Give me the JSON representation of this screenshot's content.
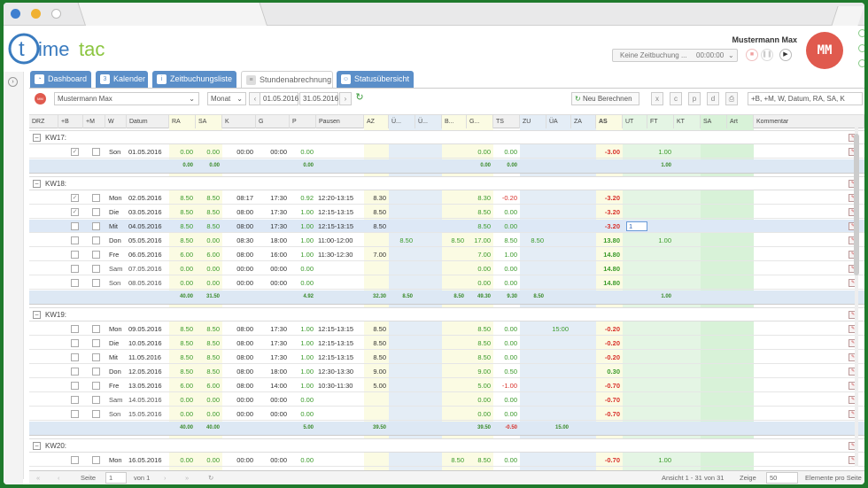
{
  "brand": {
    "logo": "timetac",
    "accent": "#5b8fc9",
    "logo_blue": "#3a7bbf",
    "logo_green": "#8bc53f"
  },
  "user": {
    "name": "Mustermann Max",
    "initials": "MM"
  },
  "clock": {
    "status": "Keine Zeitbuchung ...",
    "time": "00:00:00"
  },
  "nav_tabs": [
    {
      "label": "Dashboard",
      "icon": "dashboard-icon"
    },
    {
      "label": "Kalender",
      "icon": "calendar-icon"
    },
    {
      "label": "Zeitbuchungsliste",
      "icon": "info-icon"
    },
    {
      "label": "Stundenabrechnung",
      "icon": "document-icon",
      "active": true
    },
    {
      "label": "Statusübersicht",
      "icon": "people-icon"
    }
  ],
  "toolbar": {
    "employee": "Mustermann Max",
    "employee_initials": "MM",
    "period": "Monat",
    "date_from": "01.05.2016",
    "date_to": "31.05.2016",
    "recalc": "Neu Berechnen",
    "columns": "+B, +M, W, Datum, RA, SA, K"
  },
  "headers": [
    "DRZ",
    "+B",
    "+M",
    "W",
    "Datum",
    "RA",
    "SA",
    "K",
    "G",
    "P",
    "Pausen",
    "AZ",
    "Ü...",
    "Ü...",
    "B...",
    "G...",
    "TS",
    "ZU",
    "ÜA",
    "ZA",
    "AS",
    "UT",
    "FT",
    "KT",
    "SA",
    "Art",
    "Kommentar"
  ],
  "groups": [
    {
      "label": "KW17:",
      "rows": [
        {
          "b": true,
          "w": "Son",
          "d": "01.05.2016",
          "ra": "0.00",
          "sa": "0.00",
          "k": "00:00",
          "g": "00:00",
          "p": "0.00",
          "pa": "",
          "az": "",
          "u1": "",
          "u2": "",
          "bz": "",
          "gz": "0.00",
          "ts": "0.00",
          "zu": "",
          "ua": "",
          "za": "",
          "as": "-3.00",
          "ut": "",
          "ft": "1.00",
          "kt": ""
        }
      ],
      "sum": {
        "ra": "0.00",
        "sa": "0.00",
        "p": "0.00",
        "az": "",
        "u1": "",
        "bz": "",
        "gz": "0.00",
        "ts": "0.00",
        "zu": "",
        "ua": "",
        "ft": "1.00"
      }
    },
    {
      "label": "KW18:",
      "rows": [
        {
          "b": true,
          "w": "Mon",
          "d": "02.05.2016",
          "ra": "8.50",
          "sa": "8.50",
          "k": "08:17",
          "g": "17:30",
          "p": "0.92",
          "pa": "12:20-13:15",
          "az": "8.30",
          "u1": "",
          "u2": "",
          "bz": "",
          "gz": "8.30",
          "ts": "-0.20",
          "zu": "",
          "ua": "",
          "za": "",
          "as": "-3.20",
          "ut": "",
          "ft": "",
          "kt": ""
        },
        {
          "b": true,
          "w": "Die",
          "d": "03.05.2016",
          "ra": "8.50",
          "sa": "8.50",
          "k": "08:00",
          "g": "17:30",
          "p": "1.00",
          "pa": "12:15-13:15",
          "az": "8.50",
          "u1": "",
          "u2": "",
          "bz": "",
          "gz": "8.50",
          "ts": "0.00",
          "zu": "",
          "ua": "",
          "za": "",
          "as": "-3.20",
          "ut": "",
          "ft": "",
          "kt": ""
        },
        {
          "b": false,
          "hl": true,
          "w": "Mit",
          "d": "04.05.2016",
          "ra": "8.50",
          "sa": "8.50",
          "k": "08:00",
          "g": "17:30",
          "p": "1.00",
          "pa": "12:15-13:15",
          "az": "8.50",
          "u1": "",
          "u2": "",
          "bz": "",
          "gz": "8.50",
          "ts": "0.00",
          "zu": "",
          "ua": "",
          "za": "",
          "as": "-3.20",
          "ut": "1",
          "ft": "",
          "kt": ""
        },
        {
          "b": false,
          "w": "Don",
          "d": "05.05.2016",
          "ra": "8.50",
          "sa": "0.00",
          "k": "08:30",
          "g": "18:00",
          "p": "1.00",
          "pa": "11:00-12:00",
          "az": "",
          "u1": "8.50",
          "u2": "",
          "bz": "8.50",
          "gz": "17.00",
          "ts": "8.50",
          "zu": "8.50",
          "ua": "",
          "za": "",
          "as": "13.80",
          "ut": "",
          "ft": "1.00",
          "kt": ""
        },
        {
          "b": false,
          "w": "Fre",
          "d": "06.05.2016",
          "ra": "6.00",
          "sa": "6.00",
          "k": "08:00",
          "g": "16:00",
          "p": "1.00",
          "pa": "11:30-12:30",
          "az": "7.00",
          "u1": "",
          "u2": "",
          "bz": "",
          "gz": "7.00",
          "ts": "1.00",
          "zu": "",
          "ua": "",
          "za": "",
          "as": "14.80",
          "ut": "",
          "ft": "",
          "kt": ""
        },
        {
          "b": false,
          "we": true,
          "w": "Sam",
          "d": "07.05.2016",
          "ra": "0.00",
          "sa": "0.00",
          "k": "00:00",
          "g": "00:00",
          "p": "0.00",
          "pa": "",
          "az": "",
          "u1": "",
          "u2": "",
          "bz": "",
          "gz": "0.00",
          "ts": "0.00",
          "zu": "",
          "ua": "",
          "za": "",
          "as": "14.80",
          "ut": "",
          "ft": "",
          "kt": ""
        },
        {
          "b": false,
          "we": true,
          "w": "Son",
          "d": "08.05.2016",
          "ra": "0.00",
          "sa": "0.00",
          "k": "00:00",
          "g": "00:00",
          "p": "0.00",
          "pa": "",
          "az": "",
          "u1": "",
          "u2": "",
          "bz": "",
          "gz": "0.00",
          "ts": "0.00",
          "zu": "",
          "ua": "",
          "za": "",
          "as": "14.80",
          "ut": "",
          "ft": "",
          "kt": ""
        }
      ],
      "sum": {
        "ra": "40.00",
        "sa": "31.50",
        "p": "4.92",
        "az": "32.30",
        "u1": "8.50",
        "bz": "8.50",
        "gz": "49.30",
        "ts": "9.30",
        "zu": "8.50",
        "ua": "",
        "ft": "1.00"
      }
    },
    {
      "label": "KW19:",
      "rows": [
        {
          "b": false,
          "w": "Mon",
          "d": "09.05.2016",
          "ra": "8.50",
          "sa": "8.50",
          "k": "08:00",
          "g": "17:30",
          "p": "1.00",
          "pa": "12:15-13:15",
          "az": "8.50",
          "u1": "",
          "u2": "",
          "bz": "",
          "gz": "8.50",
          "ts": "0.00",
          "zu": "",
          "ua": "15:00",
          "za": "",
          "as": "-0.20",
          "ut": "",
          "ft": "",
          "kt": ""
        },
        {
          "b": false,
          "w": "Die",
          "d": "10.05.2016",
          "ra": "8.50",
          "sa": "8.50",
          "k": "08:00",
          "g": "17:30",
          "p": "1.00",
          "pa": "12:15-13:15",
          "az": "8.50",
          "u1": "",
          "u2": "",
          "bz": "",
          "gz": "8.50",
          "ts": "0.00",
          "zu": "",
          "ua": "",
          "za": "",
          "as": "-0.20",
          "ut": "",
          "ft": "",
          "kt": ""
        },
        {
          "b": false,
          "w": "Mit",
          "d": "11.05.2016",
          "ra": "8.50",
          "sa": "8.50",
          "k": "08:00",
          "g": "17:30",
          "p": "1.00",
          "pa": "12:15-13:15",
          "az": "8.50",
          "u1": "",
          "u2": "",
          "bz": "",
          "gz": "8.50",
          "ts": "0.00",
          "zu": "",
          "ua": "",
          "za": "",
          "as": "-0.20",
          "ut": "",
          "ft": "",
          "kt": ""
        },
        {
          "b": false,
          "w": "Don",
          "d": "12.05.2016",
          "ra": "8.50",
          "sa": "8.50",
          "k": "08:00",
          "g": "18:00",
          "p": "1.00",
          "pa": "12:30-13:30",
          "az": "9.00",
          "u1": "",
          "u2": "",
          "bz": "",
          "gz": "9.00",
          "ts": "0.50",
          "zu": "",
          "ua": "",
          "za": "",
          "as": "0.30",
          "ut": "",
          "ft": "",
          "kt": ""
        },
        {
          "b": false,
          "w": "Fre",
          "d": "13.05.2016",
          "ra": "6.00",
          "sa": "6.00",
          "k": "08:00",
          "g": "14:00",
          "p": "1.00",
          "pa": "10:30-11:30",
          "az": "5.00",
          "u1": "",
          "u2": "",
          "bz": "",
          "gz": "5.00",
          "ts": "-1.00",
          "zu": "",
          "ua": "",
          "za": "",
          "as": "-0.70",
          "ut": "",
          "ft": "",
          "kt": ""
        },
        {
          "b": false,
          "we": true,
          "w": "Sam",
          "d": "14.05.2016",
          "ra": "0.00",
          "sa": "0.00",
          "k": "00:00",
          "g": "00:00",
          "p": "0.00",
          "pa": "",
          "az": "",
          "u1": "",
          "u2": "",
          "bz": "",
          "gz": "0.00",
          "ts": "0.00",
          "zu": "",
          "ua": "",
          "za": "",
          "as": "-0.70",
          "ut": "",
          "ft": "",
          "kt": ""
        },
        {
          "b": false,
          "we": true,
          "w": "Son",
          "d": "15.05.2016",
          "ra": "0.00",
          "sa": "0.00",
          "k": "00:00",
          "g": "00:00",
          "p": "0.00",
          "pa": "",
          "az": "",
          "u1": "",
          "u2": "",
          "bz": "",
          "gz": "0.00",
          "ts": "0.00",
          "zu": "",
          "ua": "",
          "za": "",
          "as": "-0.70",
          "ut": "",
          "ft": "",
          "kt": ""
        }
      ],
      "sum": {
        "ra": "40.00",
        "sa": "40.00",
        "p": "5.00",
        "az": "39.50",
        "u1": "",
        "bz": "",
        "gz": "39.50",
        "ts": "-0.50",
        "zu": "",
        "ua": "15.00",
        "ft": ""
      }
    },
    {
      "label": "KW20:",
      "rows": [
        {
          "b": false,
          "w": "Mon",
          "d": "16.05.2016",
          "ra": "0.00",
          "sa": "0.00",
          "k": "00:00",
          "g": "00:00",
          "p": "0.00",
          "pa": "",
          "az": "",
          "u1": "",
          "u2": "",
          "bz": "8.50",
          "gz": "8.50",
          "ts": "0.00",
          "zu": "",
          "ua": "",
          "za": "",
          "as": "-0.70",
          "ut": "",
          "ft": "1.00",
          "kt": ""
        }
      ]
    }
  ],
  "pager": {
    "page_label": "Seite",
    "page": "1",
    "of": "von 1",
    "info": "Ansicht 1 - 31 von 31",
    "show": "Zeige",
    "per_page": "50",
    "per_page_label": "Elemente pro Seite"
  }
}
